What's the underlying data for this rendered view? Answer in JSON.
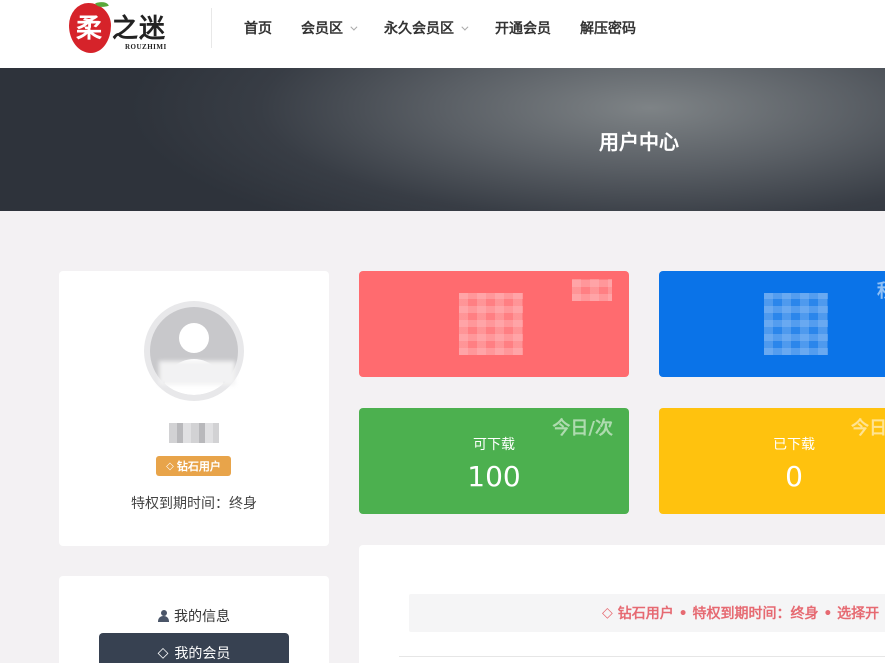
{
  "header": {
    "logo": {
      "text": "柔之迷",
      "subtext": "ROUZHIMI"
    },
    "nav": [
      {
        "label": "首页",
        "has_dropdown": false
      },
      {
        "label": "会员区",
        "has_dropdown": true
      },
      {
        "label": "永久会员区",
        "has_dropdown": true
      },
      {
        "label": "开通会员",
        "has_dropdown": false
      },
      {
        "label": "解压密码",
        "has_dropdown": false
      }
    ]
  },
  "banner": {
    "title": "用户中心"
  },
  "profile": {
    "avatar_icon": "user-avatar-icon",
    "username": "■■■",
    "badge": {
      "icon": "diamond-icon",
      "label": "钻石用户"
    },
    "expire_text": "特权到期时间：终身"
  },
  "stats": {
    "red": {
      "corner": ""
    },
    "blue": {
      "corner": "积"
    },
    "green": {
      "corner": "今日/次",
      "label": "可下载",
      "value": "100"
    },
    "yellow": {
      "corner": "今日",
      "label": "已下载",
      "value": "0"
    }
  },
  "info_menu": {
    "title_icon": "user-icon",
    "title": "我的信息",
    "member_button": {
      "icon": "diamond-icon",
      "label": "我的会员"
    }
  },
  "notice": {
    "icon": "diamond-icon",
    "text": "钻石用户 • 特权到期时间：终身 • 选择开"
  },
  "colors": {
    "red": "#ff6b6f",
    "blue": "#0a73e8",
    "green": "#4cb04f",
    "yellow": "#ffc20e",
    "badge": "#e8a44a",
    "button": "#374151",
    "notice_text": "#e66a72"
  }
}
